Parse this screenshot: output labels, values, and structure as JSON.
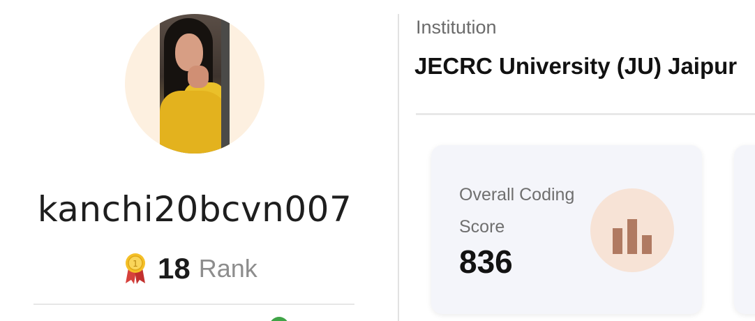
{
  "profile": {
    "username": "kanchi20bcvn007",
    "rank_value": "18",
    "rank_label": "Rank"
  },
  "institution": {
    "label": "Institution",
    "name": "JECRC University (JU) Jaipur"
  },
  "score_card": {
    "label": "Overall Coding Score",
    "value": "836",
    "icon": "bar-chart-icon"
  },
  "colors": {
    "avatar_bg": "#fdf0e0",
    "card_bg": "#f4f5fa",
    "chart_bubble_bg": "#f7e3d6",
    "chart_bar": "#b07a62",
    "medal_gold": "#f5c028",
    "ribbon_red": "#d6413c"
  }
}
